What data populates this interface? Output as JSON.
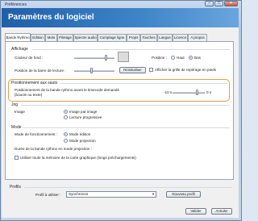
{
  "window": {
    "title": "Préférences",
    "header_title": "Paramètres du logiciel"
  },
  "tabs": [
    {
      "label": "Bande Rythmo"
    },
    {
      "label": "Edition"
    },
    {
      "label": "Mots"
    },
    {
      "label": "Piletage"
    },
    {
      "label": "Spectre audio"
    },
    {
      "label": "Comptage ligne"
    },
    {
      "label": "Projet"
    },
    {
      "label": "Touches"
    },
    {
      "label": "Langue"
    },
    {
      "label": "Licence"
    },
    {
      "label": "A propos"
    }
  ],
  "affichage": {
    "group_label": "Affichage",
    "couleur_label": "Couleur de fond :",
    "position_label": "Position :",
    "haut_label": "Haut",
    "bas_label": "Bas",
    "position_barre_label": "Position de la barre de lecture :",
    "reinit_button": "Réinitialiser",
    "afficher_grille_label": "Afficher la grille de repérage en pieds",
    "position_selected": "Bas",
    "couleur_slider_level": 0.78,
    "barre_slider_level": 0.42
  },
  "positionnement": {
    "group_label": "Positionnement aux sauts",
    "description": "Positionnement de la bande rythmo avant le timecode demandé\n(boucle ou texte)",
    "min_label": "-10 s",
    "max_label": "0 s",
    "slider_level": 0.77
  },
  "jog": {
    "group_label": "Jog",
    "image_label": "Image",
    "opt1": "Image par image",
    "opt2": "Lecture progressive",
    "selected": "Image par image"
  },
  "mode": {
    "group_label": "Mode",
    "fonctionnement_label": "Mode de fonctionnement :",
    "opt1": "Mode édition",
    "opt2": "Mode projection",
    "duree_label": "Durée de la bande rythmo en mode projection :",
    "utiliser_label": "Utiliser toute la mémoire de la carte graphique (longs préchargements)",
    "selected": "Mode édition"
  },
  "profils": {
    "group_label": "Profils",
    "utiliser_label": "Profil à utiliser :",
    "selected_value": "Synchronos",
    "nouveau_button": "Nouveau profil"
  },
  "footer": {
    "valider_button": "Valider",
    "annuler_button": "Annuler"
  },
  "colors": {
    "header_blue": "#1e5fa8",
    "highlight_orange": "#e0a04a"
  },
  "icons": {
    "minimize": "minimize-icon",
    "maximize": "maximize-icon",
    "close": "close-icon",
    "dropdown": "chevron-down-icon"
  }
}
